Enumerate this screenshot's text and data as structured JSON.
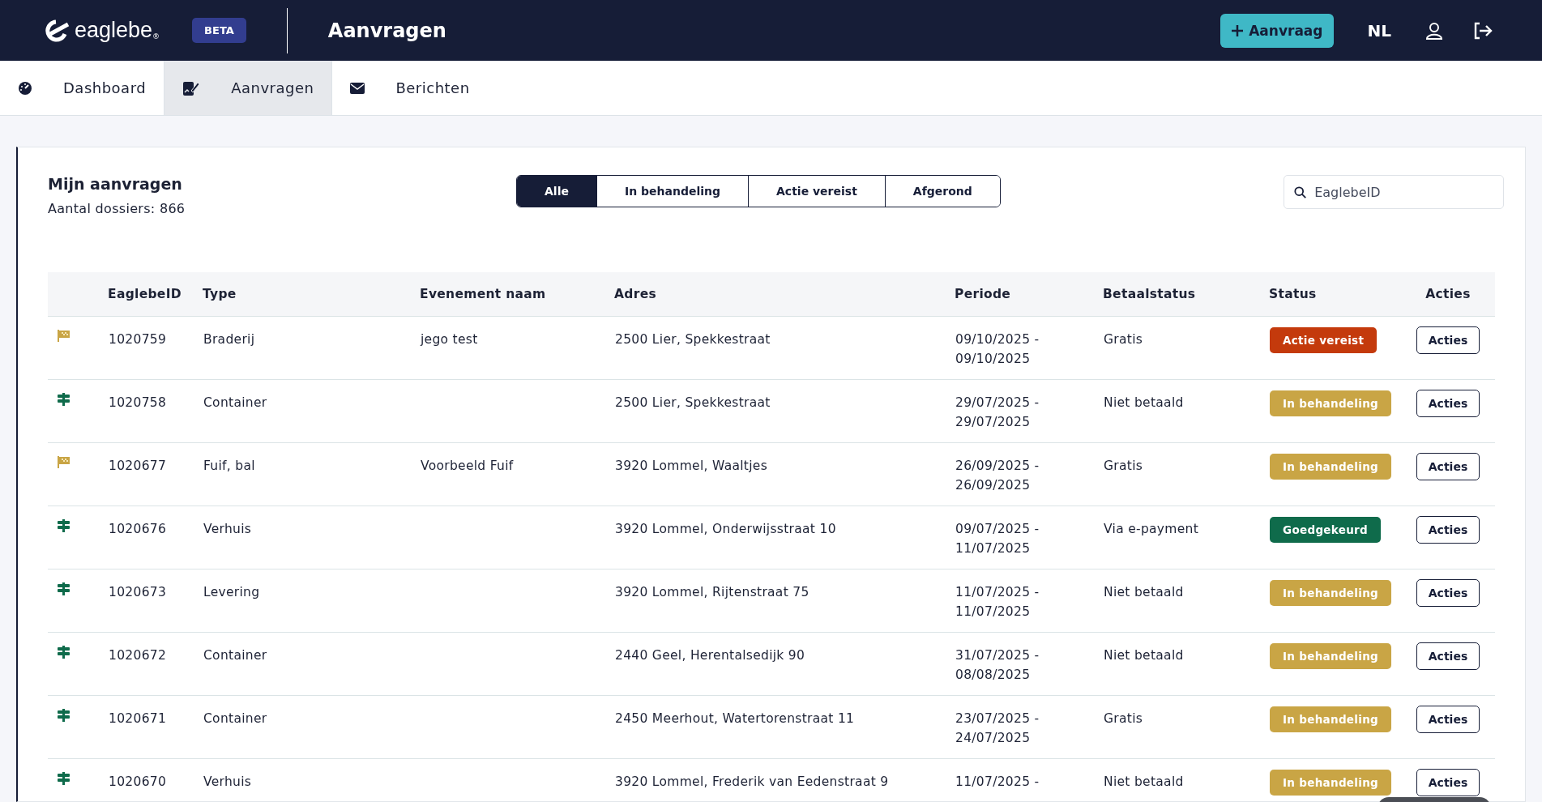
{
  "header": {
    "logo": "eaglebe",
    "logo_mark": "®",
    "badge": "BETA",
    "title": "Aanvragen",
    "new_button": "Aanvraag",
    "language": "NL"
  },
  "nav": [
    {
      "label": "Dashboard",
      "kind": "gauge",
      "selected": false
    },
    {
      "label": "Aanvragen",
      "kind": "edit",
      "selected": true
    },
    {
      "label": "Berichten",
      "kind": "mail",
      "selected": false
    }
  ],
  "panel": {
    "title": "Mijn aanvragen",
    "count": "Aantal dossiers: 866",
    "filters": [
      {
        "label": "Alle",
        "selected": true
      },
      {
        "label": "In behandeling",
        "selected": false
      },
      {
        "label": "Actie vereist",
        "selected": false
      },
      {
        "label": "Afgerond",
        "selected": false
      }
    ],
    "search": {
      "placeholder": "EaglebeID"
    }
  },
  "table": {
    "columns": [
      "EaglebeID",
      "Type",
      "Evenement naam",
      "Adres",
      "Periode",
      "Betaalstatus",
      "Status",
      "Acties"
    ],
    "rows": [
      {
        "kind": "flag",
        "id": "1020759",
        "type": "Braderij",
        "event": "jego test",
        "address": "2500 Lier, Spekkestraat",
        "period": [
          "09/10/2025 -",
          "09/10/2025"
        ],
        "payment": "Gratis",
        "status": {
          "label": "Actie vereist",
          "color": "#c43a0c"
        },
        "action": "Acties"
      },
      {
        "kind": "signpost",
        "id": "1020758",
        "type": "Container",
        "address": "2500 Lier, Spekkestraat",
        "period": [
          "29/07/2025 -",
          "29/07/2025"
        ],
        "payment": "Niet betaald",
        "status": {
          "label": "In behandeling",
          "color": "#c9a545"
        },
        "action": "Acties"
      },
      {
        "kind": "flag",
        "id": "1020677",
        "type": "Fuif, bal",
        "event": "Voorbeeld Fuif",
        "address": "3920 Lommel, Waaltjes",
        "period": [
          "26/09/2025 -",
          "26/09/2025"
        ],
        "payment": "Gratis",
        "status": {
          "label": "In behandeling",
          "color": "#c9a545"
        },
        "action": "Acties"
      },
      {
        "kind": "signpost",
        "id": "1020676",
        "type": "Verhuis",
        "address": "3920 Lommel, Onderwijsstraat 10",
        "period": [
          "09/07/2025 -",
          "11/07/2025"
        ],
        "payment": "Via e-payment",
        "status": {
          "label": "Goedgekeurd",
          "color": "#0f6b4b"
        },
        "action": "Acties"
      },
      {
        "kind": "signpost",
        "id": "1020673",
        "type": "Levering",
        "address": "3920 Lommel, Rijtenstraat 75",
        "period": [
          "11/07/2025 -",
          "11/07/2025"
        ],
        "payment": "Niet betaald",
        "status": {
          "label": "In behandeling",
          "color": "#c9a545"
        },
        "action": "Acties"
      },
      {
        "kind": "signpost",
        "id": "1020672",
        "type": "Container",
        "address": "2440 Geel, Herentalsedijk 90",
        "period": [
          "31/07/2025 -",
          "08/08/2025"
        ],
        "payment": "Niet betaald",
        "status": {
          "label": "In behandeling",
          "color": "#c9a545"
        },
        "action": "Acties"
      },
      {
        "kind": "signpost",
        "id": "1020671",
        "type": "Container",
        "address": "2450 Meerhout, Watertorenstraat 11",
        "period": [
          "23/07/2025 -",
          "24/07/2025"
        ],
        "payment": "Gratis",
        "status": {
          "label": "In behandeling",
          "color": "#c9a545"
        },
        "action": "Acties"
      },
      {
        "kind": "signpost",
        "id": "1020670",
        "type": "Verhuis",
        "address": "3920 Lommel, Frederik van Eedenstraat 9",
        "period": [
          "11/07/2025 -"
        ],
        "payment": "Niet betaald",
        "status": {
          "label": "In behandeling",
          "color": "#c9a545"
        },
        "action": "Acties"
      }
    ]
  }
}
